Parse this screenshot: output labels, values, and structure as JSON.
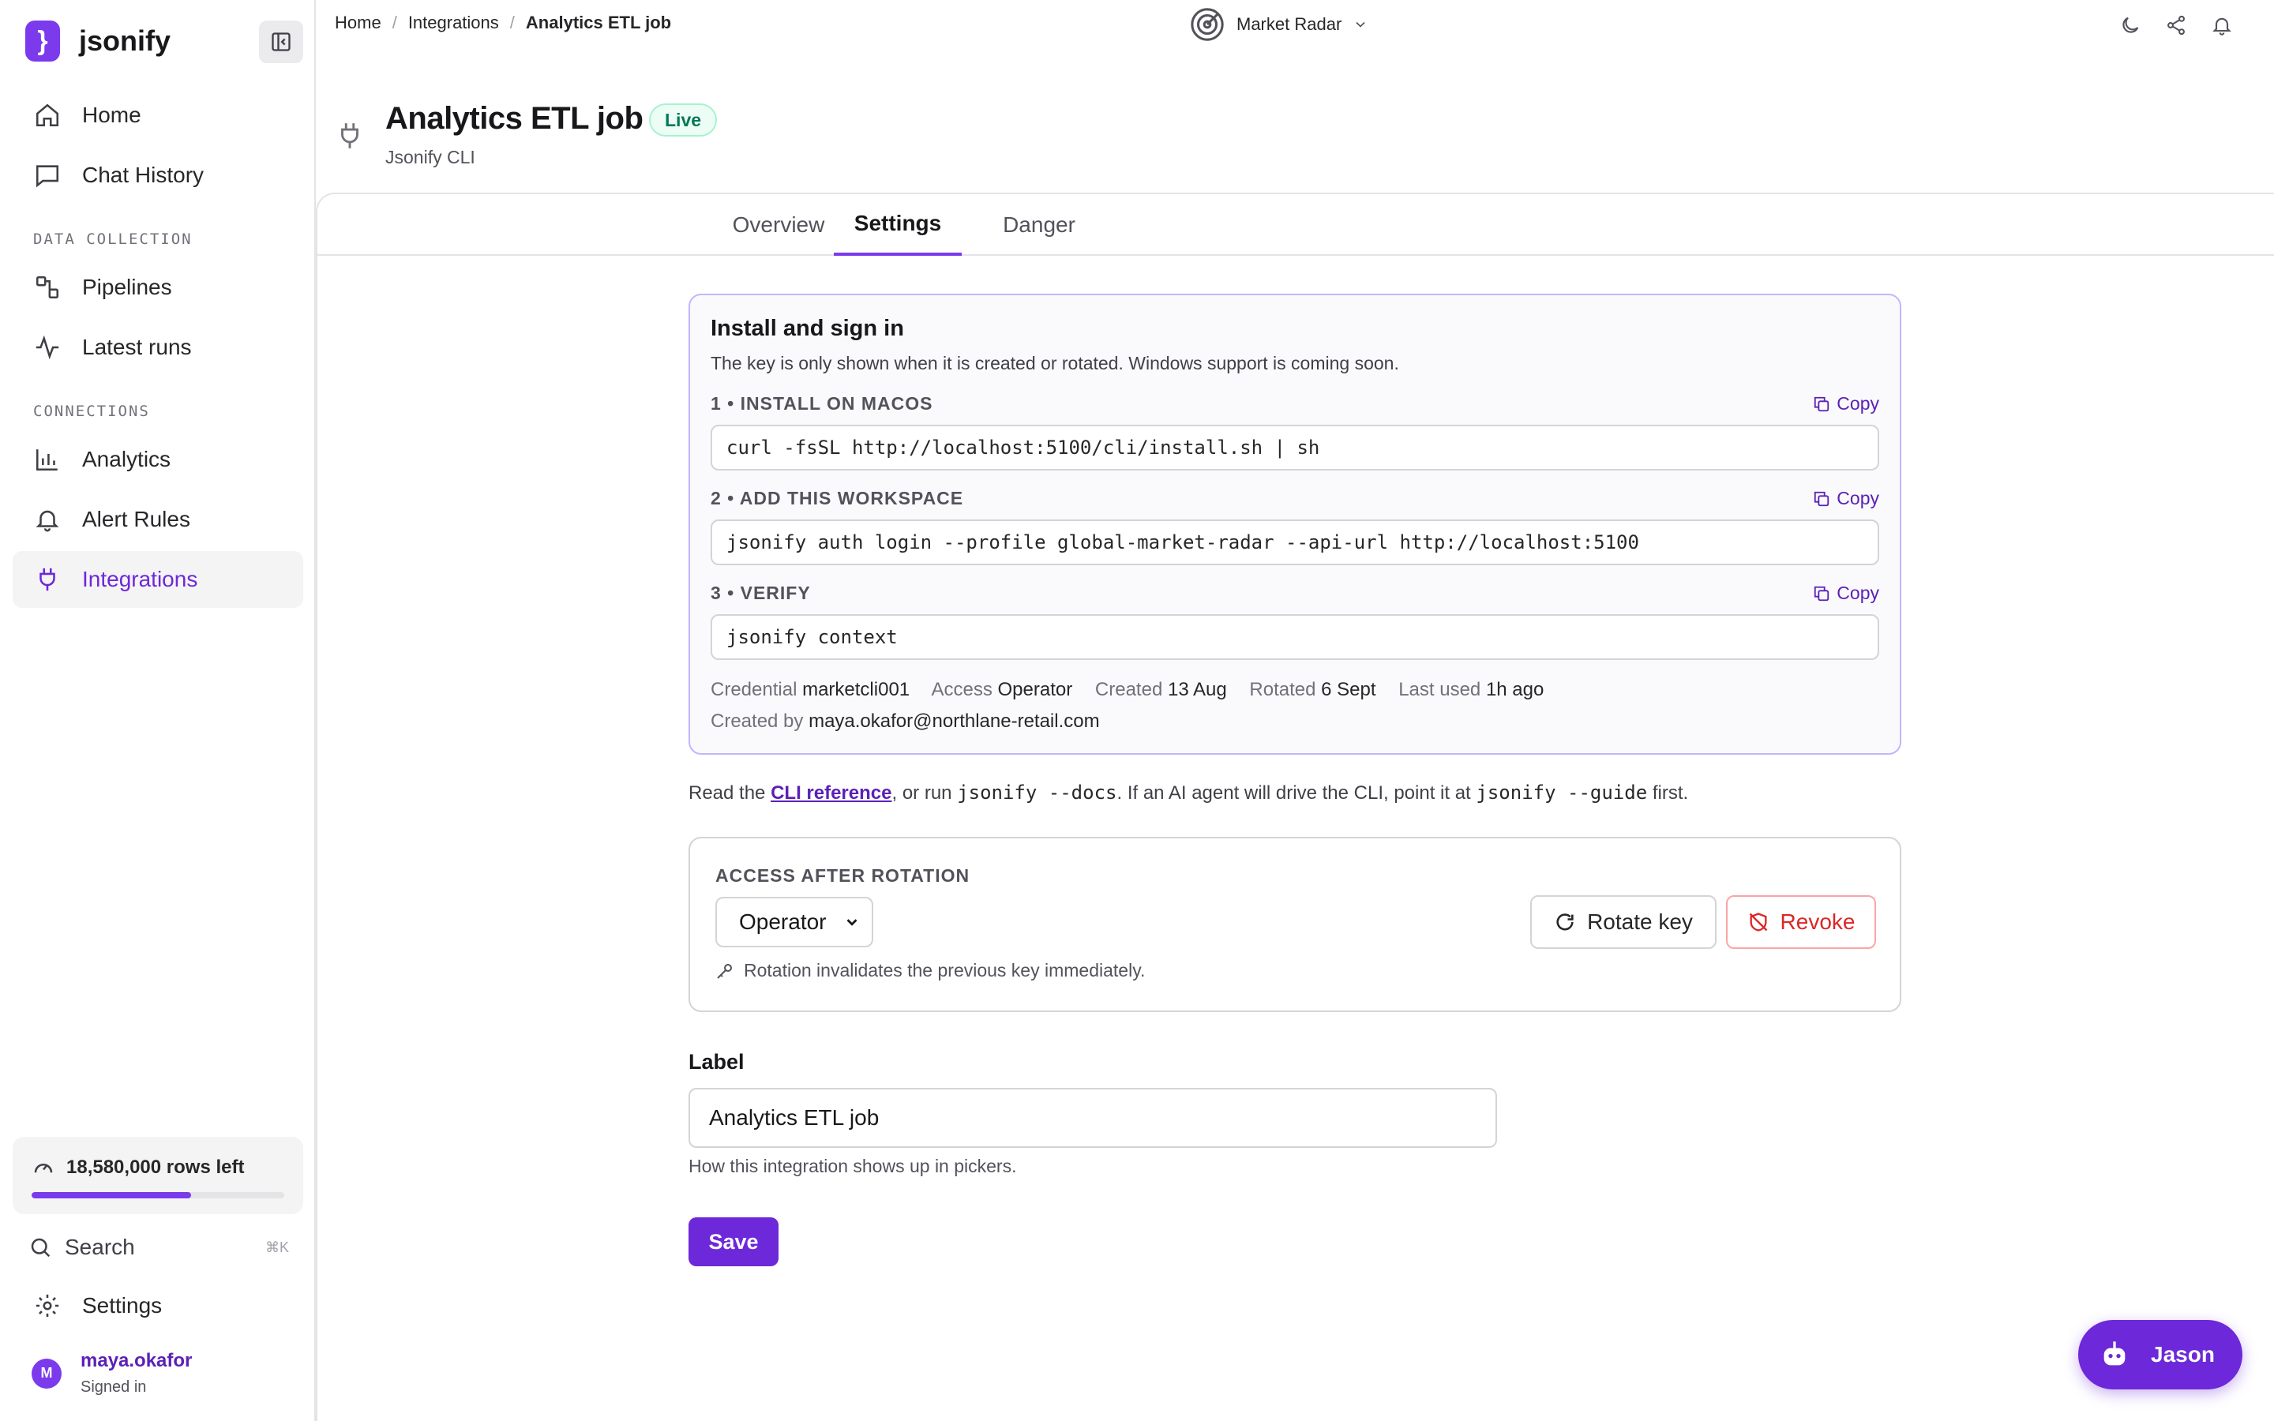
{
  "brand": {
    "logo_glyph": "}",
    "name": "jsonify",
    "accent": "#7c3aed"
  },
  "sidebar": {
    "top_items": [
      {
        "label": "Home",
        "icon": "home-icon"
      },
      {
        "label": "Chat History",
        "icon": "chat-icon"
      }
    ],
    "sections": [
      {
        "title": "DATA COLLECTION",
        "items": [
          {
            "label": "Pipelines",
            "icon": "pipeline-icon"
          },
          {
            "label": "Latest runs",
            "icon": "activity-icon"
          }
        ]
      },
      {
        "title": "CONNECTIONS",
        "items": [
          {
            "label": "Analytics",
            "icon": "bar-chart-icon"
          },
          {
            "label": "Alert Rules",
            "icon": "bell-icon"
          },
          {
            "label": "Integrations",
            "icon": "plug-icon",
            "active": true
          }
        ]
      }
    ],
    "quota": {
      "label": "18,580,000 rows left",
      "fraction_used": 0.63
    },
    "search": {
      "label": "Search",
      "shortcut": "⌘K"
    },
    "settings": {
      "label": "Settings"
    },
    "user": {
      "initial": "M",
      "name": "maya.okafor",
      "status": "Signed in"
    }
  },
  "breadcrumb": {
    "items": [
      "Home",
      "Integrations"
    ],
    "current": "Analytics ETL job"
  },
  "workspace": {
    "name": "Market Radar"
  },
  "header": {
    "title": "Analytics ETL job",
    "badge": "Live",
    "subtitle": "Jsonify CLI"
  },
  "tabs": [
    {
      "label": "Overview"
    },
    {
      "label": "Settings",
      "active": true
    },
    {
      "label": "Danger"
    }
  ],
  "install": {
    "title": "Install and sign in",
    "subtitle": "The key is only shown when it is created or rotated. Windows support is coming soon.",
    "copy_label": "Copy",
    "steps": [
      {
        "heading": "1 • INSTALL ON MACOS",
        "command": "curl -fsSL http://localhost:5100/cli/install.sh | sh"
      },
      {
        "heading": "2 • ADD THIS WORKSPACE",
        "command": "jsonify auth login --profile global-market-radar --api-url http://localhost:5100"
      },
      {
        "heading": "3 • VERIFY",
        "command": "jsonify context"
      }
    ],
    "meta": {
      "credential_label": "Credential",
      "credential": "marketcli001",
      "access_label": "Access",
      "access": "Operator",
      "created_label": "Created",
      "created": "13 Aug",
      "rotated_label": "Rotated",
      "rotated": "6 Sept",
      "last_used_label": "Last used",
      "last_used": "1h ago",
      "created_by_label": "Created by",
      "created_by": "maya.okafor@northlane-retail.com"
    }
  },
  "docs_line": {
    "prefix": "Read the ",
    "link": "CLI reference",
    "mid1": ", or run ",
    "cmd1": "jsonify --docs",
    "mid2": ". If an AI agent will drive the CLI, point it at ",
    "cmd2": "jsonify --guide",
    "suffix": " first."
  },
  "rotation": {
    "label": "ACCESS AFTER ROTATION",
    "selected_role": "Operator",
    "note": "Rotation invalidates the previous key immediately.",
    "rotate_label": "Rotate key",
    "revoke_label": "Revoke"
  },
  "label_field": {
    "title": "Label",
    "value": "Analytics ETL job",
    "help": "How this integration shows up in pickers.",
    "save_label": "Save"
  },
  "assistant": {
    "label": "Jason"
  }
}
